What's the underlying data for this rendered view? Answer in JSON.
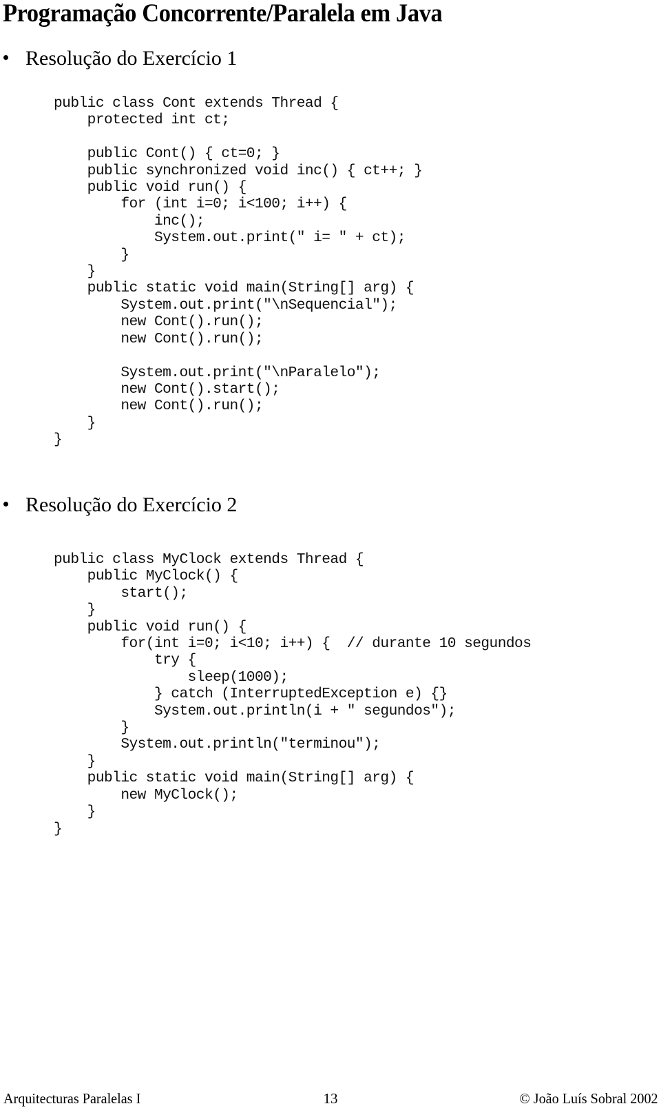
{
  "document": {
    "title": "Programação Concorrente/Paralela em Java"
  },
  "sections": [
    {
      "heading": "Resolução do Exercício 1",
      "code": "public class Cont extends Thread {\n    protected int ct;\n\n    public Cont() { ct=0; }\n    public synchronized void inc() { ct++; }\n    public void run() {\n        for (int i=0; i<100; i++) {\n            inc();\n            System.out.print(\" i= \" + ct);\n        }\n    }\n    public static void main(String[] arg) {\n        System.out.print(\"\\nSequencial\");\n        new Cont().run();\n        new Cont().run();\n\n        System.out.print(\"\\nParalelo\");\n        new Cont().start();\n        new Cont().run();\n    }\n}"
    },
    {
      "heading": "Resolução do Exercício 2",
      "code": "public class MyClock extends Thread {\n    public MyClock() {\n        start();\n    }\n    public void run() {\n        for(int i=0; i<10; i++) {  // durante 10 segundos\n            try {\n                sleep(1000);\n            } catch (InterruptedException e) {}\n            System.out.println(i + \" segundos\");\n        }\n        System.out.println(\"terminou\");\n    }\n    public static void main(String[] arg) {\n        new MyClock();\n    }\n}"
    }
  ],
  "footer": {
    "left": "Arquitecturas Paralelas I",
    "page_number": "13",
    "right": "© João Luís Sobral 2002"
  }
}
